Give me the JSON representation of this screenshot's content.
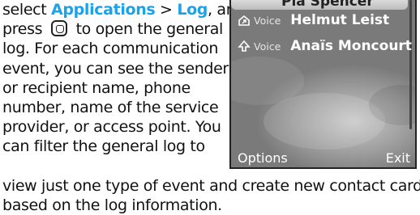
{
  "manual": {
    "top_lines": [
      {
        "pre": "select ",
        "link1": "Applications",
        "mid": " > ",
        "link2": "Log",
        "post": ", and"
      },
      {
        "pre": "press ",
        "post": " to open the general"
      },
      {
        "text": "log. For each communication"
      },
      {
        "text": "event, you can see the sender"
      },
      {
        "text": "or recipient name, phone"
      },
      {
        "text": "number, name of the service"
      },
      {
        "text": "provider, or access point. You"
      },
      {
        "text": "can filter the general log to"
      }
    ],
    "bottom_lines": [
      "view just one type of event and create new contact cards",
      "based on the log information."
    ]
  },
  "phone": {
    "selected_name": "Pia Spencer",
    "entries": [
      {
        "type": "Voice",
        "name": "Helmut Leist",
        "icon": "outgoing-call-icon"
      },
      {
        "type": "Voice",
        "name": "Anaïs Moncourt",
        "icon": "incoming-call-icon"
      }
    ],
    "softkeys": {
      "left": "Options",
      "right": "Exit"
    }
  }
}
